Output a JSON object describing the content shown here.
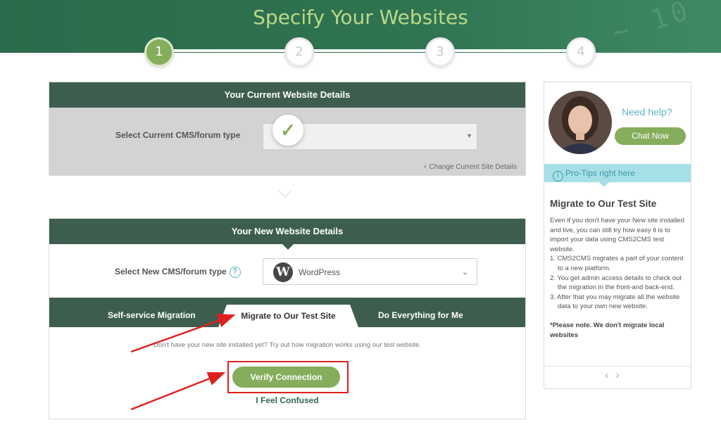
{
  "header": {
    "title": "Specify Your Websites"
  },
  "steps": [
    "1",
    "2",
    "3",
    "4"
  ],
  "current_site": {
    "heading": "Your Current Website Details",
    "select_label": "Select Current CMS/forum type",
    "change_link": "Change Current Site Details"
  },
  "new_site": {
    "heading": "Your New Website Details",
    "select_label": "Select New CMS/forum type",
    "help_symbol": "?",
    "selected_cms": "WordPress",
    "cms_logo_letter": "W"
  },
  "tabs": [
    {
      "label": "Self-service Migration"
    },
    {
      "label": "Migrate to Our Test Site"
    },
    {
      "label": "Do Everything for Me"
    }
  ],
  "test_site": {
    "hint": "Don't have your new site installed yet? Try out how migration works using our test website.",
    "verify_label": "Verify Connection",
    "confused_label": "I Feel Confused"
  },
  "sidebar": {
    "need_help": "Need help?",
    "chat_label": "Chat Now",
    "pro_tips": "Pro-Tips right here",
    "tip_title": "Migrate to Our Test Site",
    "intro": "Even if you don't have your New site installed and live, you can still try how easy it is to import your data using CMS2CMS test website.",
    "items": [
      "1. CMS2CMS migrates a part of your content to a new platform.",
      "2. You get admin access details to check out the migration in the front-and back-end.",
      "3. After that you may migrate all the website data to your own new website."
    ],
    "note": "*Please note. We don't migrate local websites"
  },
  "colors": {
    "header_green": "#2f7350",
    "panel_head": "#3d5e4f",
    "accent_green": "#86ad5b",
    "help_blue": "#5fb4c8",
    "annotation_red": "#e02020"
  }
}
